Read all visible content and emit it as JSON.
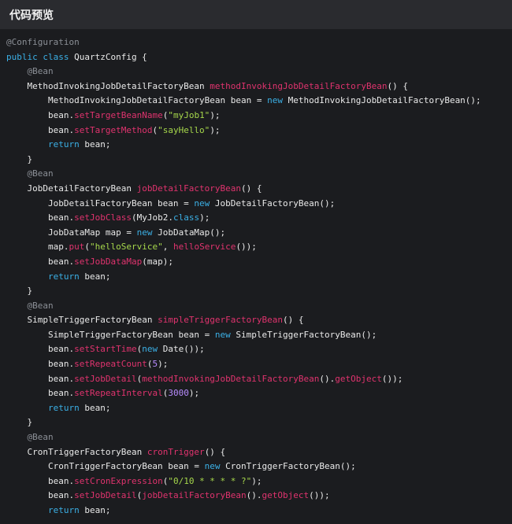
{
  "header": {
    "title": "代码预览"
  },
  "code_lines": [
    {
      "indent": 0,
      "tokens": [
        {
          "t": "@Configuration",
          "c": "ann"
        }
      ]
    },
    {
      "indent": 0,
      "tokens": [
        {
          "t": "public class ",
          "c": "kw"
        },
        {
          "t": "QuartzConfig {",
          "c": "plain"
        }
      ]
    },
    {
      "indent": 1,
      "tokens": [
        {
          "t": "@Bean",
          "c": "ann"
        }
      ]
    },
    {
      "indent": 1,
      "tokens": [
        {
          "t": "MethodInvokingJobDetailFactoryBean ",
          "c": "plain"
        },
        {
          "t": "methodInvokingJobDetailFactoryBean",
          "c": "method"
        },
        {
          "t": "() {",
          "c": "plain"
        }
      ]
    },
    {
      "indent": 2,
      "tokens": [
        {
          "t": "MethodInvokingJobDetailFactoryBean bean = ",
          "c": "plain"
        },
        {
          "t": "new ",
          "c": "kw"
        },
        {
          "t": "MethodInvokingJobDetailFactoryBean();",
          "c": "plain"
        }
      ]
    },
    {
      "indent": 2,
      "tokens": [
        {
          "t": "bean.",
          "c": "plain"
        },
        {
          "t": "setTargetBeanName",
          "c": "method"
        },
        {
          "t": "(",
          "c": "plain"
        },
        {
          "t": "\"myJob1\"",
          "c": "str"
        },
        {
          "t": ");",
          "c": "plain"
        }
      ]
    },
    {
      "indent": 2,
      "tokens": [
        {
          "t": "bean.",
          "c": "plain"
        },
        {
          "t": "setTargetMethod",
          "c": "method"
        },
        {
          "t": "(",
          "c": "plain"
        },
        {
          "t": "\"sayHello\"",
          "c": "str"
        },
        {
          "t": ");",
          "c": "plain"
        }
      ]
    },
    {
      "indent": 2,
      "tokens": [
        {
          "t": "return ",
          "c": "kw"
        },
        {
          "t": "bean;",
          "c": "plain"
        }
      ]
    },
    {
      "indent": 1,
      "tokens": [
        {
          "t": "}",
          "c": "plain"
        }
      ]
    },
    {
      "indent": 1,
      "tokens": [
        {
          "t": "@Bean",
          "c": "ann"
        }
      ]
    },
    {
      "indent": 1,
      "tokens": [
        {
          "t": "JobDetailFactoryBean ",
          "c": "plain"
        },
        {
          "t": "jobDetailFactoryBean",
          "c": "method"
        },
        {
          "t": "() {",
          "c": "plain"
        }
      ]
    },
    {
      "indent": 2,
      "tokens": [
        {
          "t": "JobDetailFactoryBean bean = ",
          "c": "plain"
        },
        {
          "t": "new ",
          "c": "kw"
        },
        {
          "t": "JobDetailFactoryBean();",
          "c": "plain"
        }
      ]
    },
    {
      "indent": 2,
      "tokens": [
        {
          "t": "bean.",
          "c": "plain"
        },
        {
          "t": "setJobClass",
          "c": "method"
        },
        {
          "t": "(MyJob2.",
          "c": "plain"
        },
        {
          "t": "class",
          "c": "kw"
        },
        {
          "t": ");",
          "c": "plain"
        }
      ]
    },
    {
      "indent": 2,
      "tokens": [
        {
          "t": "JobDataMap map = ",
          "c": "plain"
        },
        {
          "t": "new ",
          "c": "kw"
        },
        {
          "t": "JobDataMap();",
          "c": "plain"
        }
      ]
    },
    {
      "indent": 2,
      "tokens": [
        {
          "t": "map.",
          "c": "plain"
        },
        {
          "t": "put",
          "c": "method"
        },
        {
          "t": "(",
          "c": "plain"
        },
        {
          "t": "\"helloService\"",
          "c": "str"
        },
        {
          "t": ", ",
          "c": "plain"
        },
        {
          "t": "helloService",
          "c": "method"
        },
        {
          "t": "());",
          "c": "plain"
        }
      ]
    },
    {
      "indent": 2,
      "tokens": [
        {
          "t": "bean.",
          "c": "plain"
        },
        {
          "t": "setJobDataMap",
          "c": "method"
        },
        {
          "t": "(map);",
          "c": "plain"
        }
      ]
    },
    {
      "indent": 2,
      "tokens": [
        {
          "t": "return ",
          "c": "kw"
        },
        {
          "t": "bean;",
          "c": "plain"
        }
      ]
    },
    {
      "indent": 1,
      "tokens": [
        {
          "t": "}",
          "c": "plain"
        }
      ]
    },
    {
      "indent": 1,
      "tokens": [
        {
          "t": "@Bean",
          "c": "ann"
        }
      ]
    },
    {
      "indent": 1,
      "tokens": [
        {
          "t": "SimpleTriggerFactoryBean ",
          "c": "plain"
        },
        {
          "t": "simpleTriggerFactoryBean",
          "c": "method"
        },
        {
          "t": "() {",
          "c": "plain"
        }
      ]
    },
    {
      "indent": 2,
      "tokens": [
        {
          "t": "SimpleTriggerFactoryBean bean = ",
          "c": "plain"
        },
        {
          "t": "new ",
          "c": "kw"
        },
        {
          "t": "SimpleTriggerFactoryBean();",
          "c": "plain"
        }
      ]
    },
    {
      "indent": 2,
      "tokens": [
        {
          "t": "bean.",
          "c": "plain"
        },
        {
          "t": "setStartTime",
          "c": "method"
        },
        {
          "t": "(",
          "c": "plain"
        },
        {
          "t": "new ",
          "c": "kw"
        },
        {
          "t": "Date());",
          "c": "plain"
        }
      ]
    },
    {
      "indent": 2,
      "tokens": [
        {
          "t": "bean.",
          "c": "plain"
        },
        {
          "t": "setRepeatCount",
          "c": "method"
        },
        {
          "t": "(",
          "c": "plain"
        },
        {
          "t": "5",
          "c": "num"
        },
        {
          "t": ");",
          "c": "plain"
        }
      ]
    },
    {
      "indent": 2,
      "tokens": [
        {
          "t": "bean.",
          "c": "plain"
        },
        {
          "t": "setJobDetail",
          "c": "method"
        },
        {
          "t": "(",
          "c": "plain"
        },
        {
          "t": "methodInvokingJobDetailFactoryBean",
          "c": "method"
        },
        {
          "t": "().",
          "c": "plain"
        },
        {
          "t": "getObject",
          "c": "method"
        },
        {
          "t": "());",
          "c": "plain"
        }
      ]
    },
    {
      "indent": 2,
      "tokens": [
        {
          "t": "bean.",
          "c": "plain"
        },
        {
          "t": "setRepeatInterval",
          "c": "method"
        },
        {
          "t": "(",
          "c": "plain"
        },
        {
          "t": "3000",
          "c": "num"
        },
        {
          "t": ");",
          "c": "plain"
        }
      ]
    },
    {
      "indent": 2,
      "tokens": [
        {
          "t": "return ",
          "c": "kw"
        },
        {
          "t": "bean;",
          "c": "plain"
        }
      ]
    },
    {
      "indent": 1,
      "tokens": [
        {
          "t": "}",
          "c": "plain"
        }
      ]
    },
    {
      "indent": 1,
      "tokens": [
        {
          "t": "@Bean",
          "c": "ann"
        }
      ]
    },
    {
      "indent": 1,
      "tokens": [
        {
          "t": "CronTriggerFactoryBean ",
          "c": "plain"
        },
        {
          "t": "cronTrigger",
          "c": "method"
        },
        {
          "t": "() {",
          "c": "plain"
        }
      ]
    },
    {
      "indent": 2,
      "tokens": [
        {
          "t": "CronTriggerFactoryBean bean = ",
          "c": "plain"
        },
        {
          "t": "new ",
          "c": "kw"
        },
        {
          "t": "CronTriggerFactoryBean();",
          "c": "plain"
        }
      ]
    },
    {
      "indent": 2,
      "tokens": [
        {
          "t": "bean.",
          "c": "plain"
        },
        {
          "t": "setCronExpression",
          "c": "method"
        },
        {
          "t": "(",
          "c": "plain"
        },
        {
          "t": "\"0/10 * * * * ?\"",
          "c": "str"
        },
        {
          "t": ");",
          "c": "plain"
        }
      ]
    },
    {
      "indent": 2,
      "tokens": [
        {
          "t": "bean.",
          "c": "plain"
        },
        {
          "t": "setJobDetail",
          "c": "method"
        },
        {
          "t": "(",
          "c": "plain"
        },
        {
          "t": "jobDetailFactoryBean",
          "c": "method"
        },
        {
          "t": "().",
          "c": "plain"
        },
        {
          "t": "getObject",
          "c": "method"
        },
        {
          "t": "());",
          "c": "plain"
        }
      ]
    },
    {
      "indent": 2,
      "tokens": [
        {
          "t": "return ",
          "c": "kw"
        },
        {
          "t": "bean;",
          "c": "plain"
        }
      ]
    }
  ]
}
